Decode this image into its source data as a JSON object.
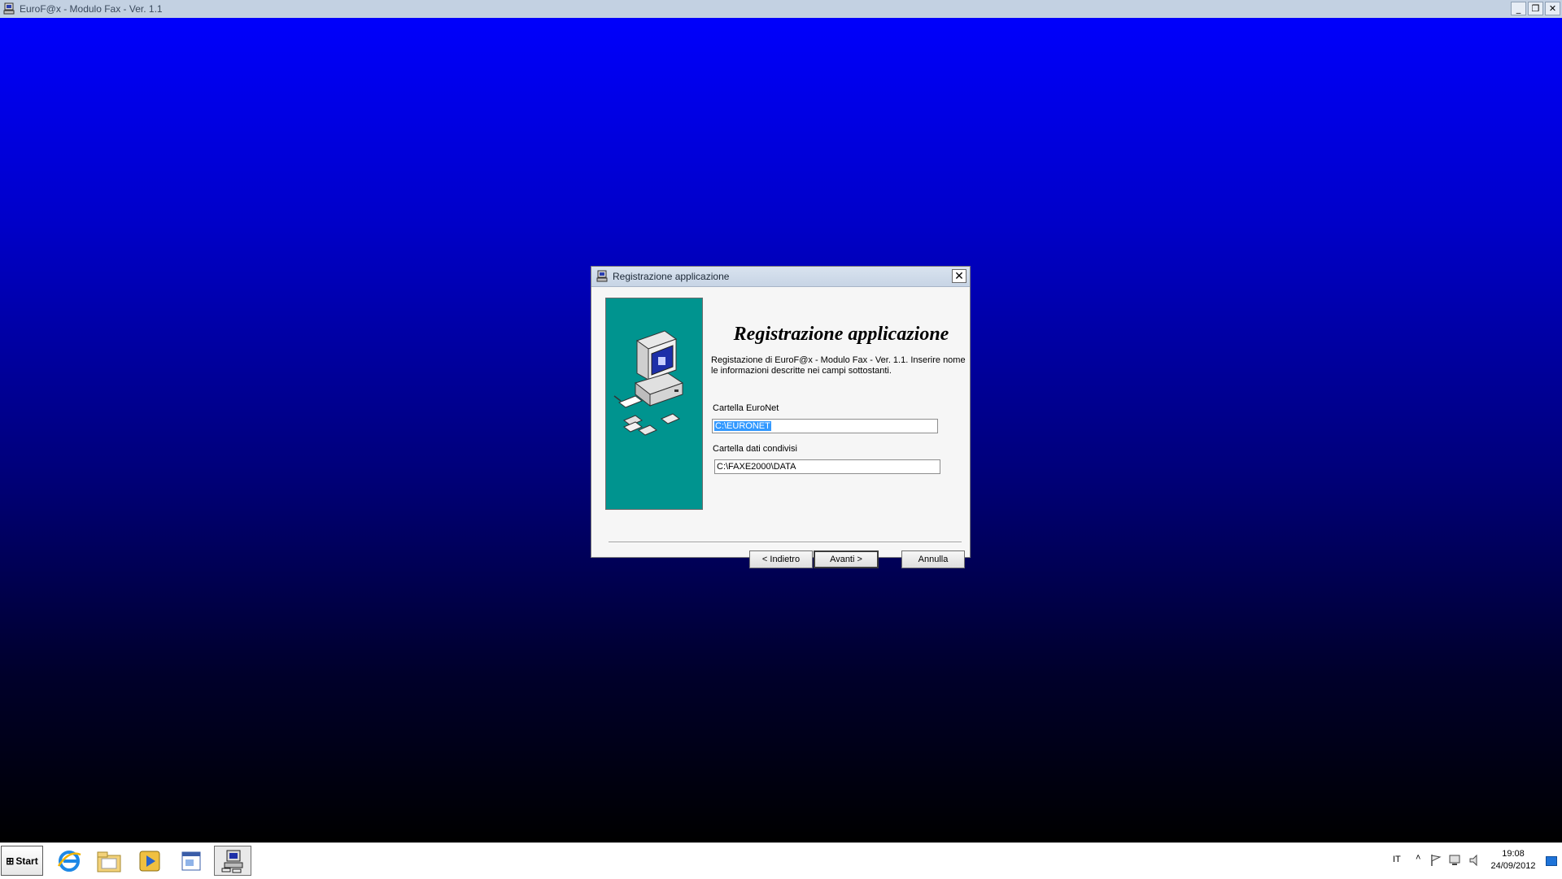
{
  "app": {
    "title": "EuroF@x - Modulo Fax  - Ver. 1.1",
    "controls": {
      "minimize": "_",
      "restore": "❐",
      "close": "✕"
    }
  },
  "dialog": {
    "title": "Registrazione applicazione",
    "close": "✕",
    "heading": "Registrazione applicazione",
    "intro": "Registazione di EuroF@x - Modulo Fax  - Ver. 1.1. Inserire nome le informazioni descritte nei campi sottostanti.",
    "fields": [
      {
        "label": "Cartella EuroNet",
        "value": "C:\\EURONET",
        "selected": true
      },
      {
        "label": "Cartella dati condivisi",
        "value": "C:\\FAXE2000\\DATA",
        "selected": false
      }
    ],
    "buttons": {
      "back": "< Indietro",
      "next": "Avanti >",
      "cancel": "Annulla"
    }
  },
  "taskbar": {
    "start": "Start",
    "items": [
      {
        "name": "internet-explorer-icon",
        "active": false
      },
      {
        "name": "file-explorer-icon",
        "active": false
      },
      {
        "name": "media-player-icon",
        "active": false
      },
      {
        "name": "document-window-icon",
        "active": false
      },
      {
        "name": "eurofax-app-icon",
        "active": true
      }
    ],
    "lang": "IT",
    "tray_arrow": "˄",
    "time": "19:08",
    "date": "24/09/2012"
  },
  "colors": {
    "desktop_top": "#0000fc",
    "desktop_bottom": "#000000",
    "side_panel": "#00948f",
    "selection": "#3399ff"
  }
}
